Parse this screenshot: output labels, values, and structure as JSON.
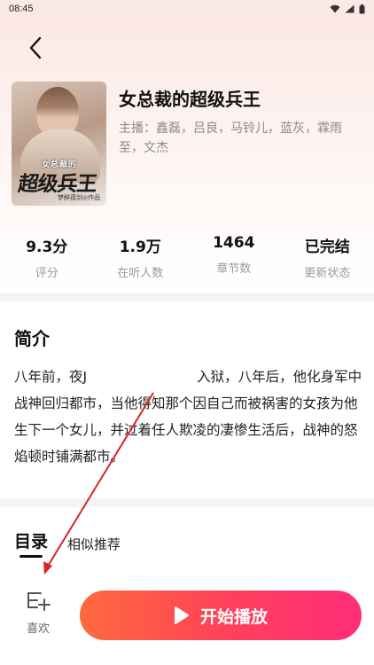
{
  "status_bar": {
    "time": "08:45"
  },
  "book": {
    "title": "女总裁的超级兵王",
    "narrators": "主播：鑫磊，吕良，马铃儿，蓝灰，霖雨至，文杰",
    "cover": {
      "small_text": "女总裁的",
      "big_text": "超级兵王",
      "author_text": "梦醉孤剑◎作品"
    }
  },
  "stats": [
    {
      "value": "9.3分",
      "label": "评分"
    },
    {
      "value": "1.9万",
      "label": "在听人数"
    },
    {
      "value": "1464",
      "label": "章节数"
    },
    {
      "value": "已完结",
      "label": "更新状态"
    }
  ],
  "intro": {
    "title": "简介",
    "text": "八年前，夜J　　　　　　　　入狱，八年后，他化身军中战神回归都市，当他得知那个因自己而被祸害的女孩为他生下一个女儿，并过着任人欺凌的凄惨生活后，战神的怒焰顿时铺满都市。"
  },
  "tabs": {
    "catalog": "目录",
    "similar": "相似推荐"
  },
  "bottom": {
    "like_label": "喜欢",
    "play_label": "开始播放"
  },
  "colors": {
    "play_gradient_start": "#ff6a3c",
    "play_gradient_end": "#ff2d78",
    "annotation_arrow": "#d9222a"
  }
}
